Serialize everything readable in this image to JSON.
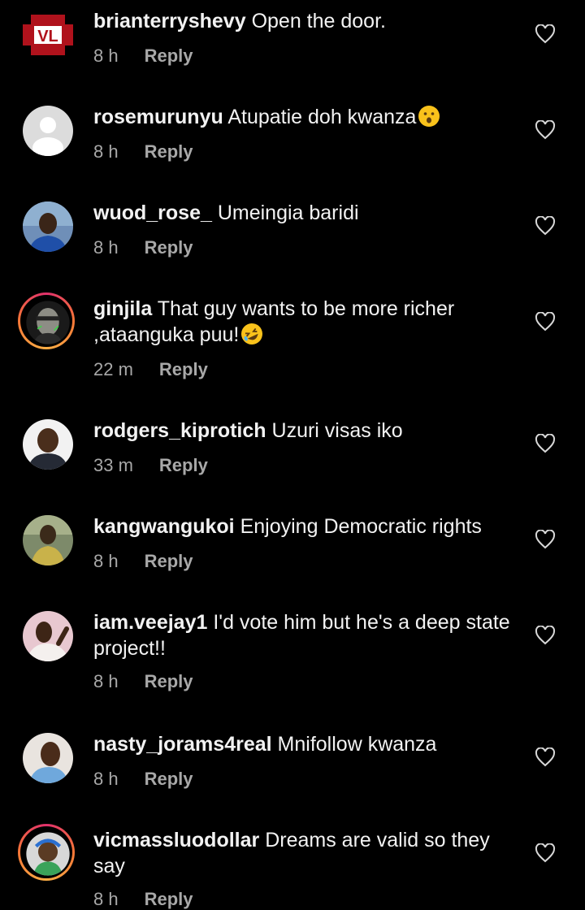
{
  "comments": [
    {
      "username": "brianterryshevy",
      "text": "Open the door.",
      "time": "8 h",
      "reply": "Reply",
      "avatar_label": "VL",
      "avatar": "logo"
    },
    {
      "username": "rosemurunyu",
      "text": "Atupatie doh kwanza",
      "emoji": "hushed-face",
      "time": "8 h",
      "reply": "Reply",
      "avatar": "default"
    },
    {
      "username": "wuod_rose_",
      "text": "Umeingia baridi",
      "time": "8 h",
      "reply": "Reply",
      "avatar": "photo"
    },
    {
      "username": "ginjila",
      "text": "That guy wants to be more richer ,ataanguka puu!",
      "emoji": "rolling-laughing",
      "time": "22 m",
      "reply": "Reply",
      "avatar": "photo",
      "story_ring": true
    },
    {
      "username": "rodgers_kiprotich",
      "text": "Uzuri visas iko",
      "time": "33 m",
      "reply": "Reply",
      "avatar": "photo"
    },
    {
      "username": "kangwangukoi",
      "text": "Enjoying Democratic rights",
      "time": "8 h",
      "reply": "Reply",
      "avatar": "photo"
    },
    {
      "username": "iam.veejay1",
      "text": "I'd vote him but he's a deep state project!!",
      "time": "8 h",
      "reply": "Reply",
      "avatar": "photo"
    },
    {
      "username": "nasty_jorams4real",
      "text": "Mnifollow kwanza",
      "time": "8 h",
      "reply": "Reply",
      "avatar": "photo"
    },
    {
      "username": "vicmassluodollar",
      "text": "Dreams are valid so they say",
      "time": "8 h",
      "reply": "Reply",
      "avatar": "photo",
      "story_ring": true
    }
  ],
  "colors": {
    "background": "#000000",
    "text": "#f2f2f2",
    "secondary": "#a8a8a8",
    "ring": "#e1306c"
  }
}
